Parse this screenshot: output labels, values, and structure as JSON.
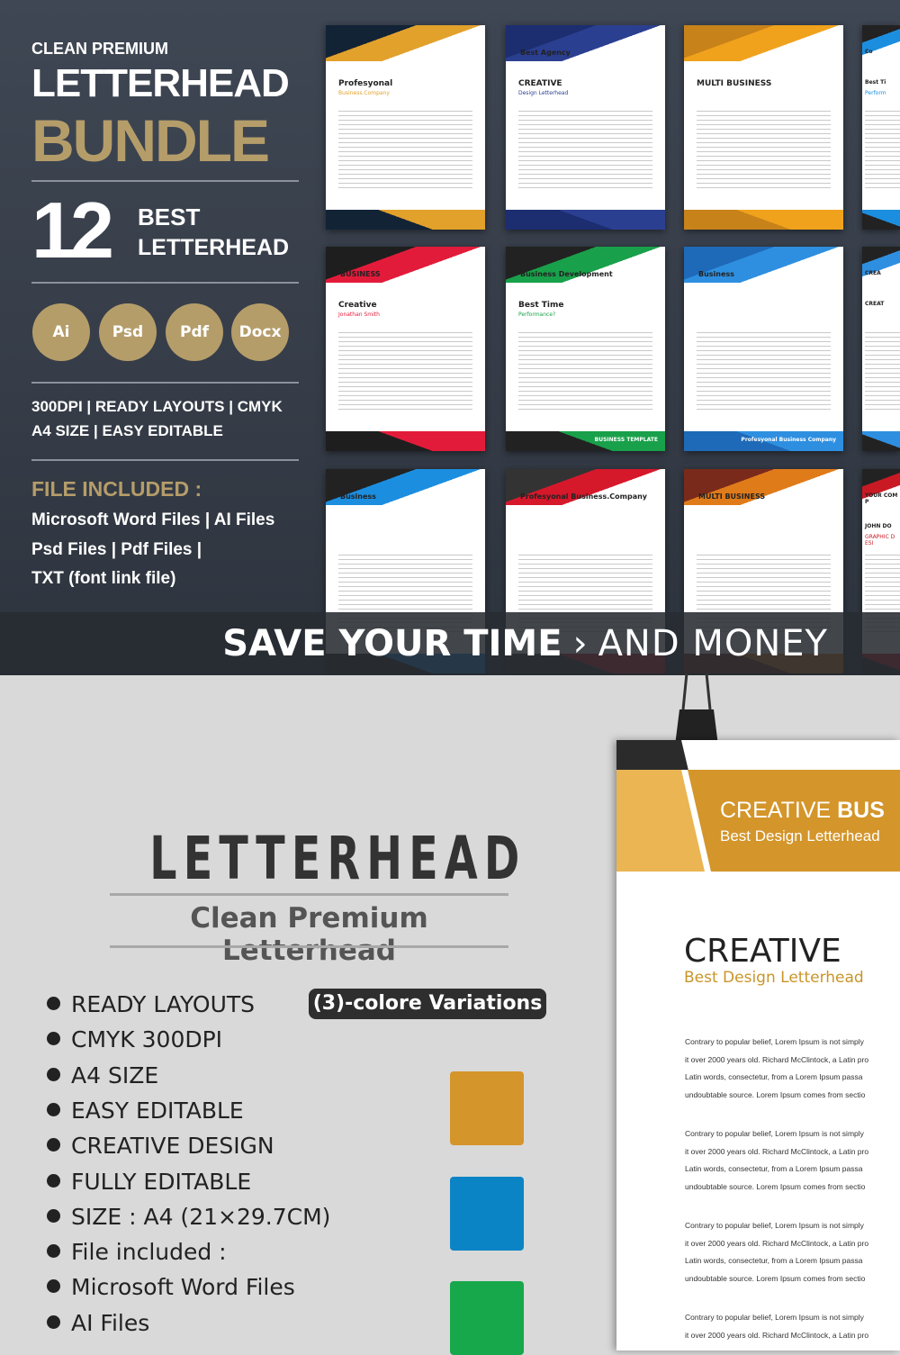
{
  "hero": {
    "kicker": "CLEAN PREMIUM",
    "title": "LETTERHEAD",
    "title_accent": "BUNDLE",
    "count": "12",
    "count_line1": "BEST",
    "count_line2": "LETTERHEAD",
    "formats": [
      "Ai",
      "Psd",
      "Pdf",
      "Docx"
    ],
    "features_line1": "300DPI | READY LAYOUTS | CMYK",
    "features_line2": "A4 SIZE | EASY EDITABLE",
    "files_heading": "FILE INCLUDED :",
    "files_lines": [
      "Microsoft Word Files | AI Files",
      "Psd Files | Pdf Files |",
      "TXT (font link file)"
    ]
  },
  "thumbnails": [
    {
      "title": "Profesyonal",
      "sub": "Business.Company",
      "accent": "#e2a12b",
      "dark": "#122336"
    },
    {
      "title": "CREATIVE",
      "sub": "Design Letterhead",
      "brand": "Best Agency",
      "accent": "#2b3f91",
      "dark": "#1c2d70"
    },
    {
      "title": "MULTI BUSINESS",
      "sub": "",
      "accent": "#f0a21c",
      "dark": "#c8821a"
    },
    {
      "title": "Best Ti",
      "sub": "Perform",
      "brand": "Co",
      "accent": "#1c8ee0",
      "dark": "#222"
    },
    {
      "title": "Creative",
      "sub": "Jonathan Smith",
      "brand": "BUSINESS",
      "accent": "#e31b3a",
      "dark": "#1e1e1e"
    },
    {
      "title": "Best Time",
      "sub": "Performance?",
      "brand": "Business Development",
      "footer": "BUSINESS TEMPLATE",
      "accent": "#19a04a",
      "dark": "#222"
    },
    {
      "title": "",
      "sub": "",
      "brand": "Business",
      "footer": "Profesyonal Business Company",
      "accent": "#2e8fe0",
      "dark": "#1e6ab8"
    },
    {
      "title": "CREAT",
      "sub": "",
      "brand": "CREA",
      "accent": "#2e8fe0",
      "dark": "#222"
    },
    {
      "title": "",
      "sub": "",
      "brand": "Business",
      "accent": "#1c8ee0",
      "dark": "#222"
    },
    {
      "title": "",
      "sub": "",
      "brand": "Profesyonal Business.Company",
      "accent": "#d6182b",
      "dark": "#333"
    },
    {
      "title": "",
      "sub": "",
      "brand": "MULTI BUSINESS",
      "accent": "#e07b1a",
      "dark": "#7a2a1a"
    },
    {
      "title": "JOHN DO",
      "sub": "GRAPHIC DESI",
      "brand": "YOUR COMP",
      "accent": "#c91a24",
      "dark": "#222"
    }
  ],
  "banner": {
    "bold": "SAVE YOUR TIME",
    "sep": "›",
    "light": "AND MONEY"
  },
  "promo": {
    "title": "LETTERHEAD",
    "subtitle": "Clean Premium Letterhead",
    "bullets": [
      "READY LAYOUTS",
      "CMYK  300DPI",
      "A4 SIZE",
      "EASY EDITABLE",
      "CREATIVE DESIGN",
      "FULLY EDITABLE",
      "SIZE : A4 (21×29.7CM)",
      "File included :",
      "Microsoft Word Files",
      "AI Files"
    ],
    "variations_label": "(3)-colore Variations",
    "colors": [
      "#d4952a",
      "#0b84c5",
      "#16a84a"
    ]
  },
  "sample": {
    "header_light": "CREATIVE ",
    "header_bold": "BUS",
    "header_sub": "Best Design Letterhead",
    "title": "CREATIVE",
    "subtitle": "Best Design Letterhead",
    "paragraph_lines": [
      "Contrary to popular belief, Lorem Ipsum is not simply",
      "it over 2000 years old. Richard McClintock, a Latin pro",
      "Latin words, consectetur, from a Lorem Ipsum passa",
      "undoubtable source. Lorem Ipsum comes from sectio"
    ]
  }
}
